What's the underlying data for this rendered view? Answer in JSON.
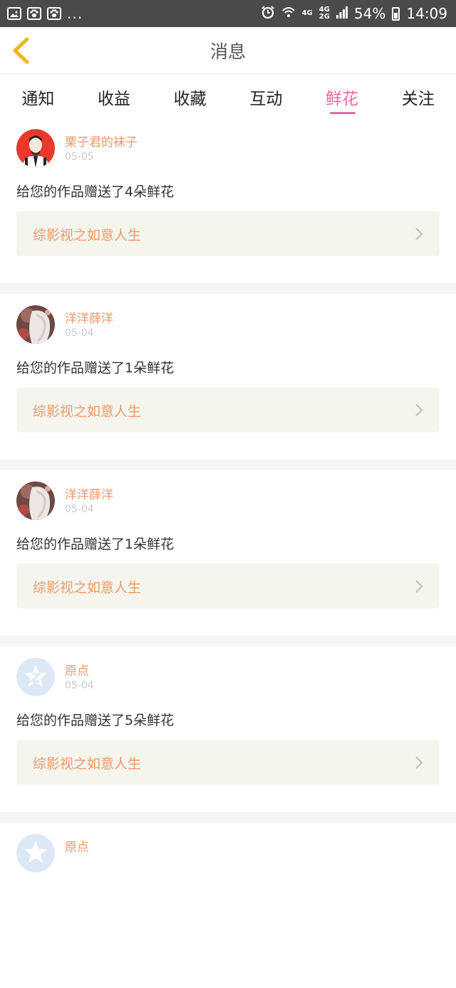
{
  "status_bar": {
    "more": "...",
    "net_4g": "4G",
    "net_4g2": "4G",
    "net_2g": "2G",
    "battery": "54%",
    "time": "14:09"
  },
  "header": {
    "title": "消息"
  },
  "tabs": [
    {
      "label": "通知"
    },
    {
      "label": "收益"
    },
    {
      "label": "收藏"
    },
    {
      "label": "互动"
    },
    {
      "label": "鲜花"
    },
    {
      "label": "关注"
    }
  ],
  "active_tab": "鲜花",
  "messages": [
    {
      "user": "栗子君的袜子",
      "date": "05-05",
      "text": "给您的作品赠送了4朵鲜花",
      "work": "综影视之如意人生",
      "avatar": "avatar-red-icon"
    },
    {
      "user": "洋洋薛洋",
      "date": "05-04",
      "text": "给您的作品赠送了1朵鲜花",
      "work": "综影视之如意人生",
      "avatar": "avatar-art-icon"
    },
    {
      "user": "洋洋薛洋",
      "date": "05-04",
      "text": "给您的作品赠送了1朵鲜花",
      "work": "综影视之如意人生",
      "avatar": "avatar-art-icon"
    },
    {
      "user": "原点",
      "date": "05-04",
      "text": "给您的作品赠送了5朵鲜花",
      "work": "综影视之如意人生",
      "avatar": "avatar-default-icon"
    },
    {
      "user": "原点",
      "date": "",
      "text": "",
      "work": "",
      "avatar": "avatar-default-icon"
    }
  ],
  "colors": {
    "accent": "#e56aa0",
    "name": "#ef9865",
    "back": "#f0b620"
  }
}
